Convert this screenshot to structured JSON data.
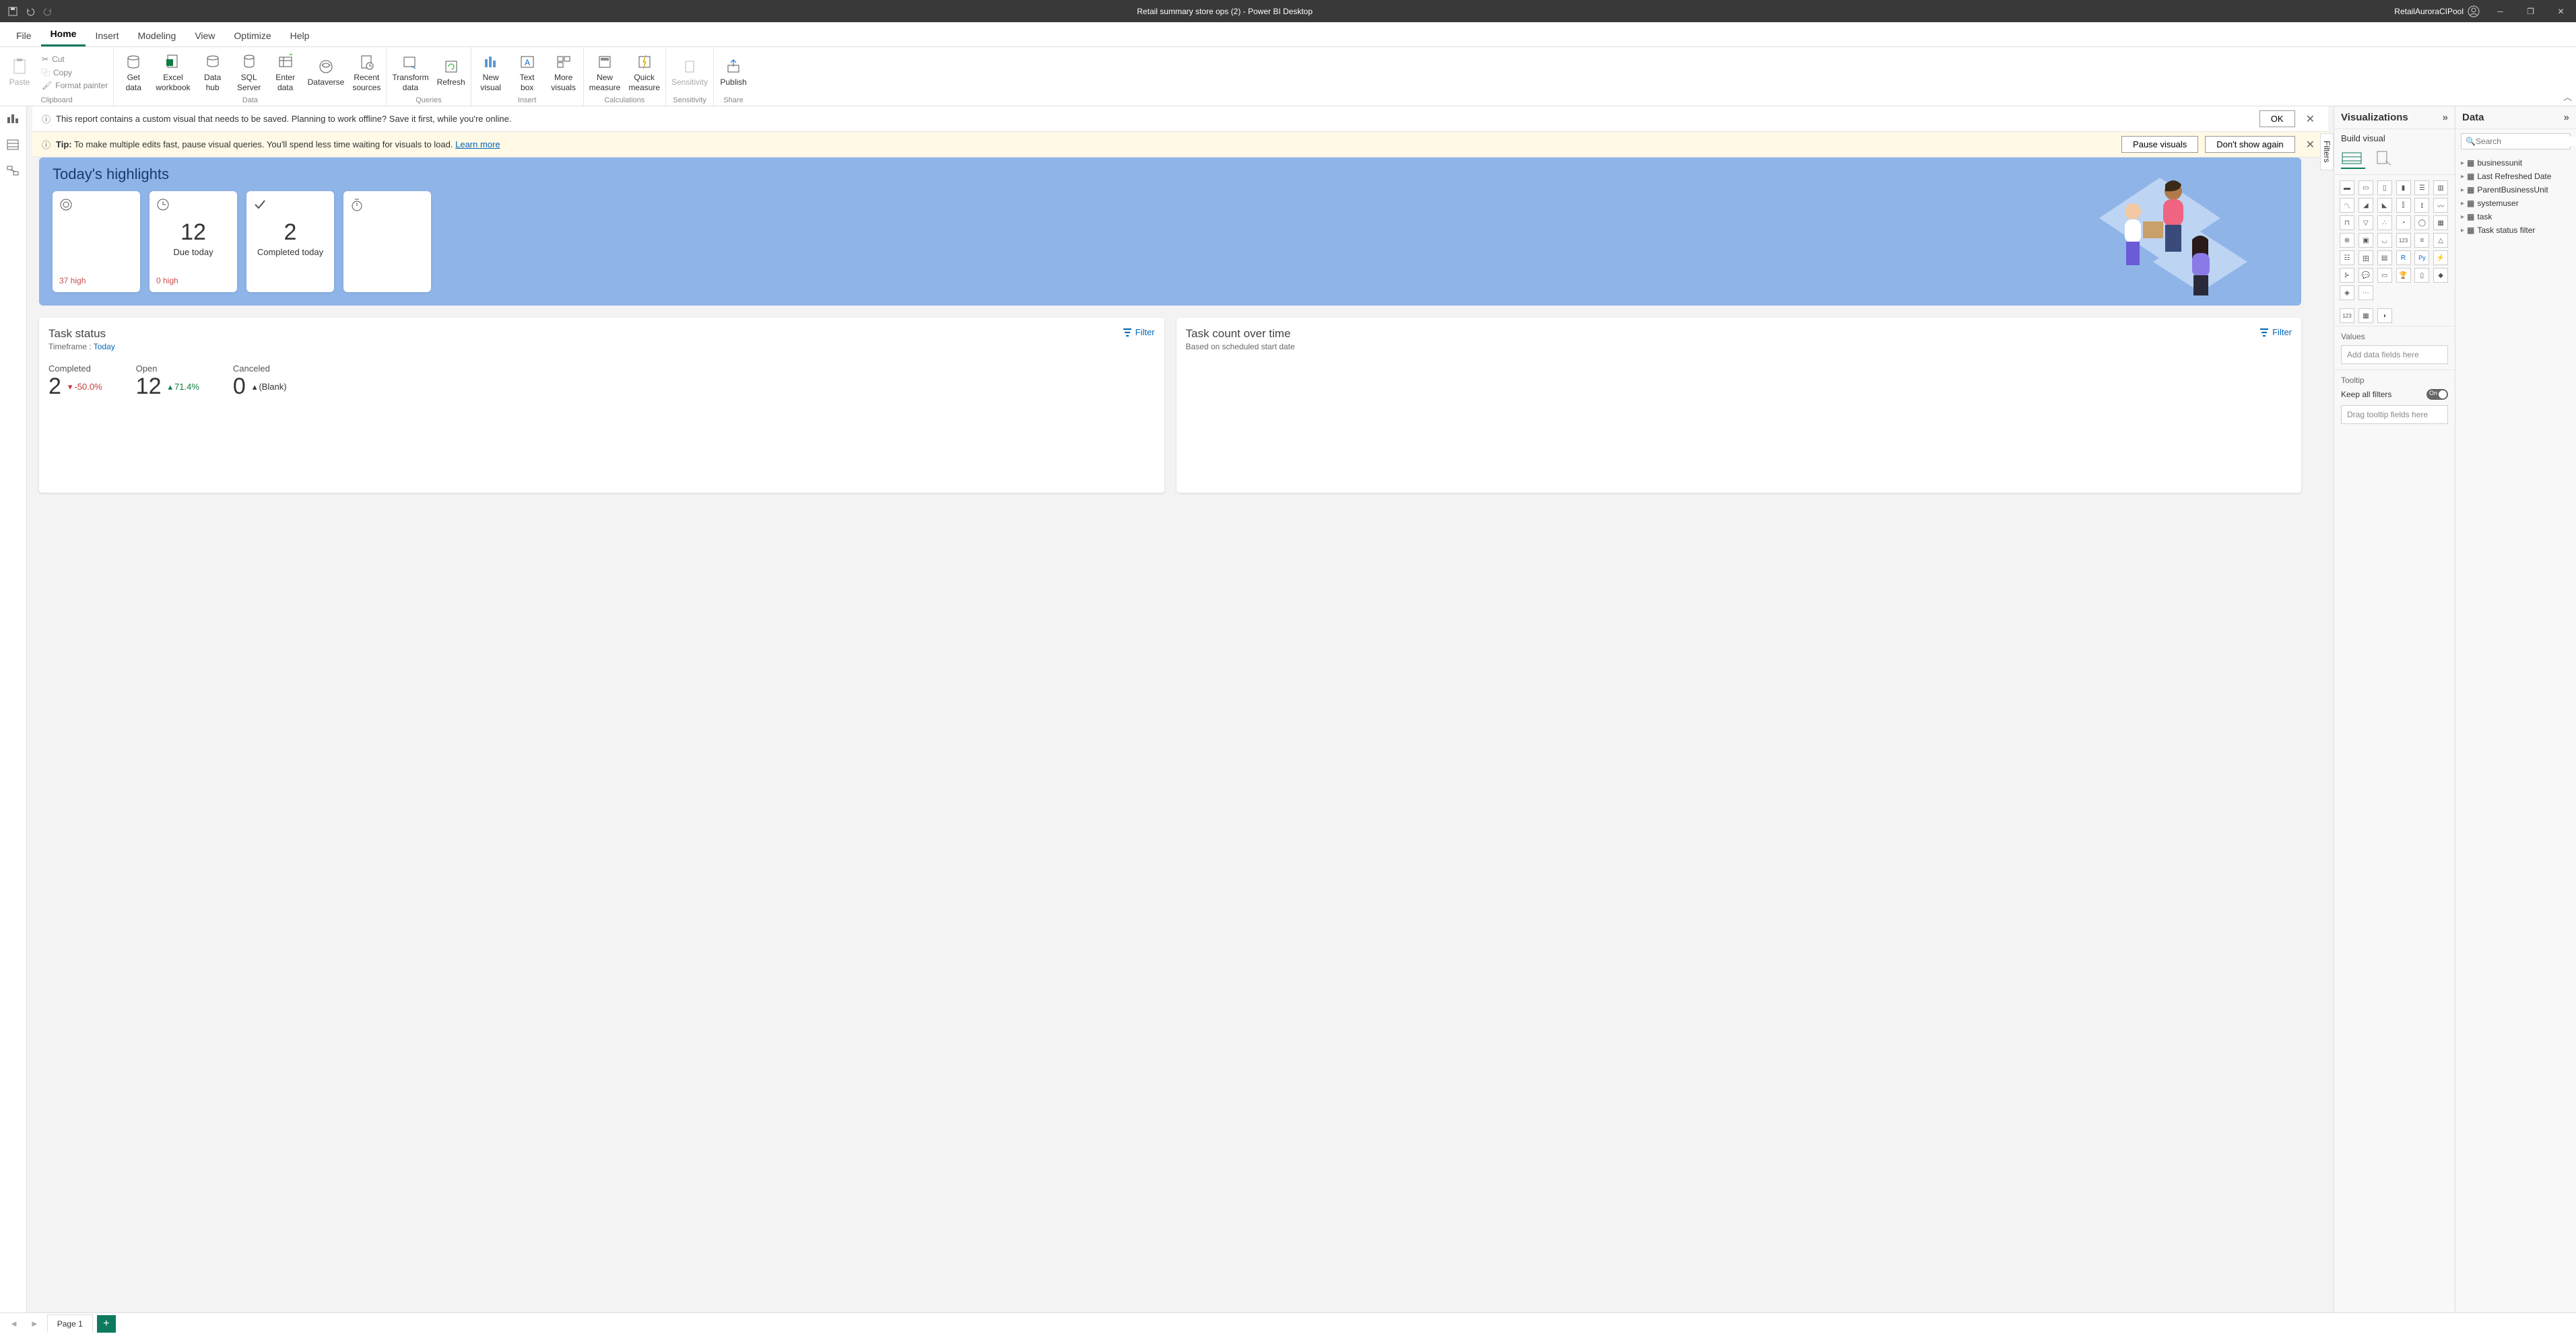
{
  "titlebar": {
    "title": "Retail summary store ops (2) - Power BI Desktop",
    "user": "RetailAuroraCIPool"
  },
  "tabs": [
    "File",
    "Home",
    "Insert",
    "Modeling",
    "View",
    "Optimize",
    "Help"
  ],
  "activeTab": "Home",
  "ribbon": {
    "clipboard": {
      "paste": "Paste",
      "cut": "Cut",
      "copy": "Copy",
      "fp": "Format painter",
      "label": "Clipboard"
    },
    "data": {
      "get": "Get\ndata",
      "excel": "Excel\nworkbook",
      "hub": "Data\nhub",
      "sql": "SQL\nServer",
      "enter": "Enter\ndata",
      "dv": "Dataverse",
      "recent": "Recent\nsources",
      "label": "Data"
    },
    "queries": {
      "transform": "Transform\ndata",
      "refresh": "Refresh",
      "label": "Queries"
    },
    "insert": {
      "nvisual": "New\nvisual",
      "tbox": "Text\nbox",
      "more": "More\nvisuals",
      "label": "Insert"
    },
    "calc": {
      "nm": "New\nmeasure",
      "qm": "Quick\nmeasure",
      "label": "Calculations"
    },
    "sens": {
      "btn": "Sensitivity",
      "label": "Sensitivity"
    },
    "share": {
      "publish": "Publish",
      "label": "Share"
    }
  },
  "banner1": {
    "msg": "This report contains a custom visual that needs to be saved. Planning to work offline? Save it first, while you're online.",
    "ok": "OK"
  },
  "banner2": {
    "tip": "Tip:",
    "msg": " To make multiple edits fast, pause visual queries. You'll spend less time waiting for visuals to load.  ",
    "link": "Learn more",
    "pause": "Pause visuals",
    "dont": "Don't show again"
  },
  "filters_label": "Filters",
  "highlights": {
    "title": "Today's highlights",
    "cards": [
      {
        "icon": "target",
        "num": "",
        "lbl": "",
        "foot": "37 high",
        "footcls": "red"
      },
      {
        "icon": "clock",
        "num": "12",
        "lbl": "Due today",
        "foot": "0 high",
        "footcls": "red2"
      },
      {
        "icon": "check",
        "num": "2",
        "lbl": "Completed today",
        "foot": ""
      },
      {
        "icon": "timer",
        "num": "",
        "lbl": "",
        "foot": ""
      }
    ]
  },
  "taskstatus": {
    "title": "Task status",
    "filter": "Filter",
    "timeframe_lbl": "Timeframe : ",
    "timeframe_val": "Today",
    "stats": [
      {
        "h": "Completed",
        "v": "2",
        "delta": "-50.0%",
        "dir": "down"
      },
      {
        "h": "Open",
        "v": "12",
        "delta": "71.4%",
        "dir": "up"
      },
      {
        "h": "Canceled",
        "v": "0",
        "delta": "(Blank)",
        "dir": "blank"
      }
    ]
  },
  "taskcount": {
    "title": "Task count over time",
    "sub": "Based on scheduled start date",
    "filter": "Filter"
  },
  "vispane": {
    "title": "Visualizations",
    "build": "Build visual",
    "values_lbl": "Values",
    "values_ph": "Add data fields here",
    "tooltip_lbl": "Tooltip",
    "keep": "Keep all filters",
    "toggle": "On",
    "tooltip_ph": "Drag tooltip fields here"
  },
  "datapane": {
    "title": "Data",
    "search_ph": "Search",
    "tables": [
      "businessunit",
      "Last Refreshed Date",
      "ParentBusinessUnit",
      "systemuser",
      "task",
      "Task status filter"
    ]
  },
  "pagebar": {
    "page": "Page 1"
  }
}
